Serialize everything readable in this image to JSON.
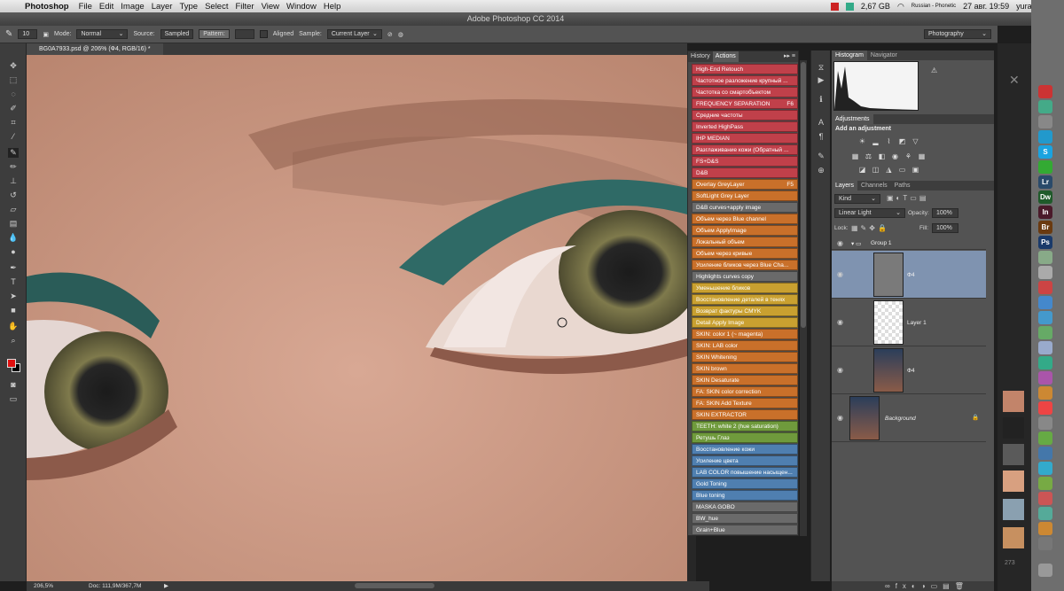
{
  "menubar": {
    "app_name": "Photoshop",
    "items": [
      "File",
      "Edit",
      "Image",
      "Layer",
      "Type",
      "Select",
      "Filter",
      "View",
      "Window",
      "Help"
    ],
    "memory": "2,67 GB",
    "keyboard": "Russian - Phonetic",
    "datetime": "27 авг. 19:59",
    "user": "yurail"
  },
  "window": {
    "title": "Adobe Photoshop CC 2014"
  },
  "options": {
    "brush_size": "10",
    "mode_label": "Mode:",
    "mode_value": "Normal",
    "source_label": "Source:",
    "sampled_label": "Sampled",
    "pattern_label": "Pattern:",
    "aligned_label": "Aligned",
    "sample_label": "Sample:",
    "sample_value": "Current Layer",
    "workspace": "Photography"
  },
  "document": {
    "tab_title": "BG0A7933.psd @ 206% (Ф4, RGB/16) *"
  },
  "status": {
    "zoom": "206,5%",
    "doc": "Doc: 111,9M/367,7M"
  },
  "actions_panel": {
    "tab_history": "History",
    "tab_actions": "Actions",
    "items": [
      {
        "label": "High-End Retouch",
        "color": "#c0404a",
        "key": ""
      },
      {
        "label": "Частотное разложение крупный ...",
        "color": "#c0404a",
        "key": ""
      },
      {
        "label": "Частотка со смартобъектом",
        "color": "#c0404a",
        "key": ""
      },
      {
        "label": "FREQUENCY SEPARATION",
        "color": "#c0404a",
        "key": "F6"
      },
      {
        "label": "Средние частоты",
        "color": "#c0404a",
        "key": ""
      },
      {
        "label": "Inverted HighPass",
        "color": "#c0404a",
        "key": ""
      },
      {
        "label": "IHP MEDIAN",
        "color": "#c0404a",
        "key": ""
      },
      {
        "label": "Разглаживание кожи (Обратный ...",
        "color": "#c0404a",
        "key": ""
      },
      {
        "label": "FS+D&S",
        "color": "#c0404a",
        "key": ""
      },
      {
        "label": "D&B",
        "color": "#c0404a",
        "key": ""
      },
      {
        "label": "Overlay GreyLayer",
        "color": "#c9702a",
        "key": "F5"
      },
      {
        "label": "SoftLight Grey Layer",
        "color": "#c9702a",
        "key": ""
      },
      {
        "label": "D&B curves+apply image",
        "color": "#6a6a6a",
        "key": ""
      },
      {
        "label": "Объем через Blue channel",
        "color": "#c9702a",
        "key": ""
      },
      {
        "label": "Объем ApplyImage",
        "color": "#c9702a",
        "key": ""
      },
      {
        "label": "Локальный объем",
        "color": "#c9702a",
        "key": ""
      },
      {
        "label": "Объем через кривые",
        "color": "#c9702a",
        "key": ""
      },
      {
        "label": "Усиление бликов через Blue Cha...",
        "color": "#c9702a",
        "key": ""
      },
      {
        "label": "Highlights curves copy",
        "color": "#6a6a6a",
        "key": ""
      },
      {
        "label": "Уменьшение бликов",
        "color": "#c9a030",
        "key": ""
      },
      {
        "label": "Восстановление деталей в тенях",
        "color": "#c9a030",
        "key": ""
      },
      {
        "label": "Возврат фактуры CMYK",
        "color": "#c9a030",
        "key": ""
      },
      {
        "label": "Detail Apply Image",
        "color": "#c9a030",
        "key": ""
      },
      {
        "label": "SKIN: color 1 (~ magenta)",
        "color": "#c9702a",
        "key": ""
      },
      {
        "label": "SKIN: LAB color",
        "color": "#c9702a",
        "key": ""
      },
      {
        "label": "SKIN Whitening",
        "color": "#c9702a",
        "key": ""
      },
      {
        "label": "SKIN brown",
        "color": "#c9702a",
        "key": ""
      },
      {
        "label": "SKIN Desaturate",
        "color": "#c9702a",
        "key": ""
      },
      {
        "label": "FA: SKIN color correction",
        "color": "#c9702a",
        "key": ""
      },
      {
        "label": "FA: SKIN Add Texture",
        "color": "#c9702a",
        "key": ""
      },
      {
        "label": "SKIN EXTRACTOR",
        "color": "#c9702a",
        "key": ""
      },
      {
        "label": "TEETH: white 2 (hue saturation)",
        "color": "#6f9a3c",
        "key": ""
      },
      {
        "label": "Ретушь Глаз",
        "color": "#6f9a3c",
        "key": ""
      },
      {
        "label": "Восстановление кожи",
        "color": "#4f7fb0",
        "key": ""
      },
      {
        "label": "Усиление цвета",
        "color": "#4f7fb0",
        "key": ""
      },
      {
        "label": "LAB COLOR повышение насыщен...",
        "color": "#4f7fb0",
        "key": ""
      },
      {
        "label": "Gold Toning",
        "color": "#4f7fb0",
        "key": ""
      },
      {
        "label": "Blue toning",
        "color": "#4f7fb0",
        "key": ""
      },
      {
        "label": "MASKA GOBO",
        "color": "#6a6a6a",
        "key": ""
      },
      {
        "label": "BW_hue",
        "color": "#6a6a6a",
        "key": ""
      },
      {
        "label": "Grain+Blue",
        "color": "#6a6a6a",
        "key": ""
      }
    ]
  },
  "right_panel": {
    "histogram_tab": "Histogram",
    "navigator_tab": "Navigator",
    "adjustments_tab": "Adjustments",
    "add_adjustment": "Add an adjustment",
    "layers_tab": "Layers",
    "channels_tab": "Channels",
    "paths_tab": "Paths",
    "kind_filter": "Kind",
    "blend_mode": "Linear Light",
    "opacity_label": "Opacity:",
    "opacity_value": "100%",
    "lock_label": "Lock:",
    "fill_label": "Fill:",
    "fill_value": "100%",
    "layers": [
      {
        "name": "Group 1"
      },
      {
        "name": "Ф4"
      },
      {
        "name": "Layer 1"
      },
      {
        "name": "Ф4"
      },
      {
        "name": "Background"
      }
    ]
  },
  "dock": {
    "badge": "273"
  },
  "colors": {
    "accent_selection": "#7f93b0",
    "foreground": "#e01010",
    "background": "#000000"
  }
}
